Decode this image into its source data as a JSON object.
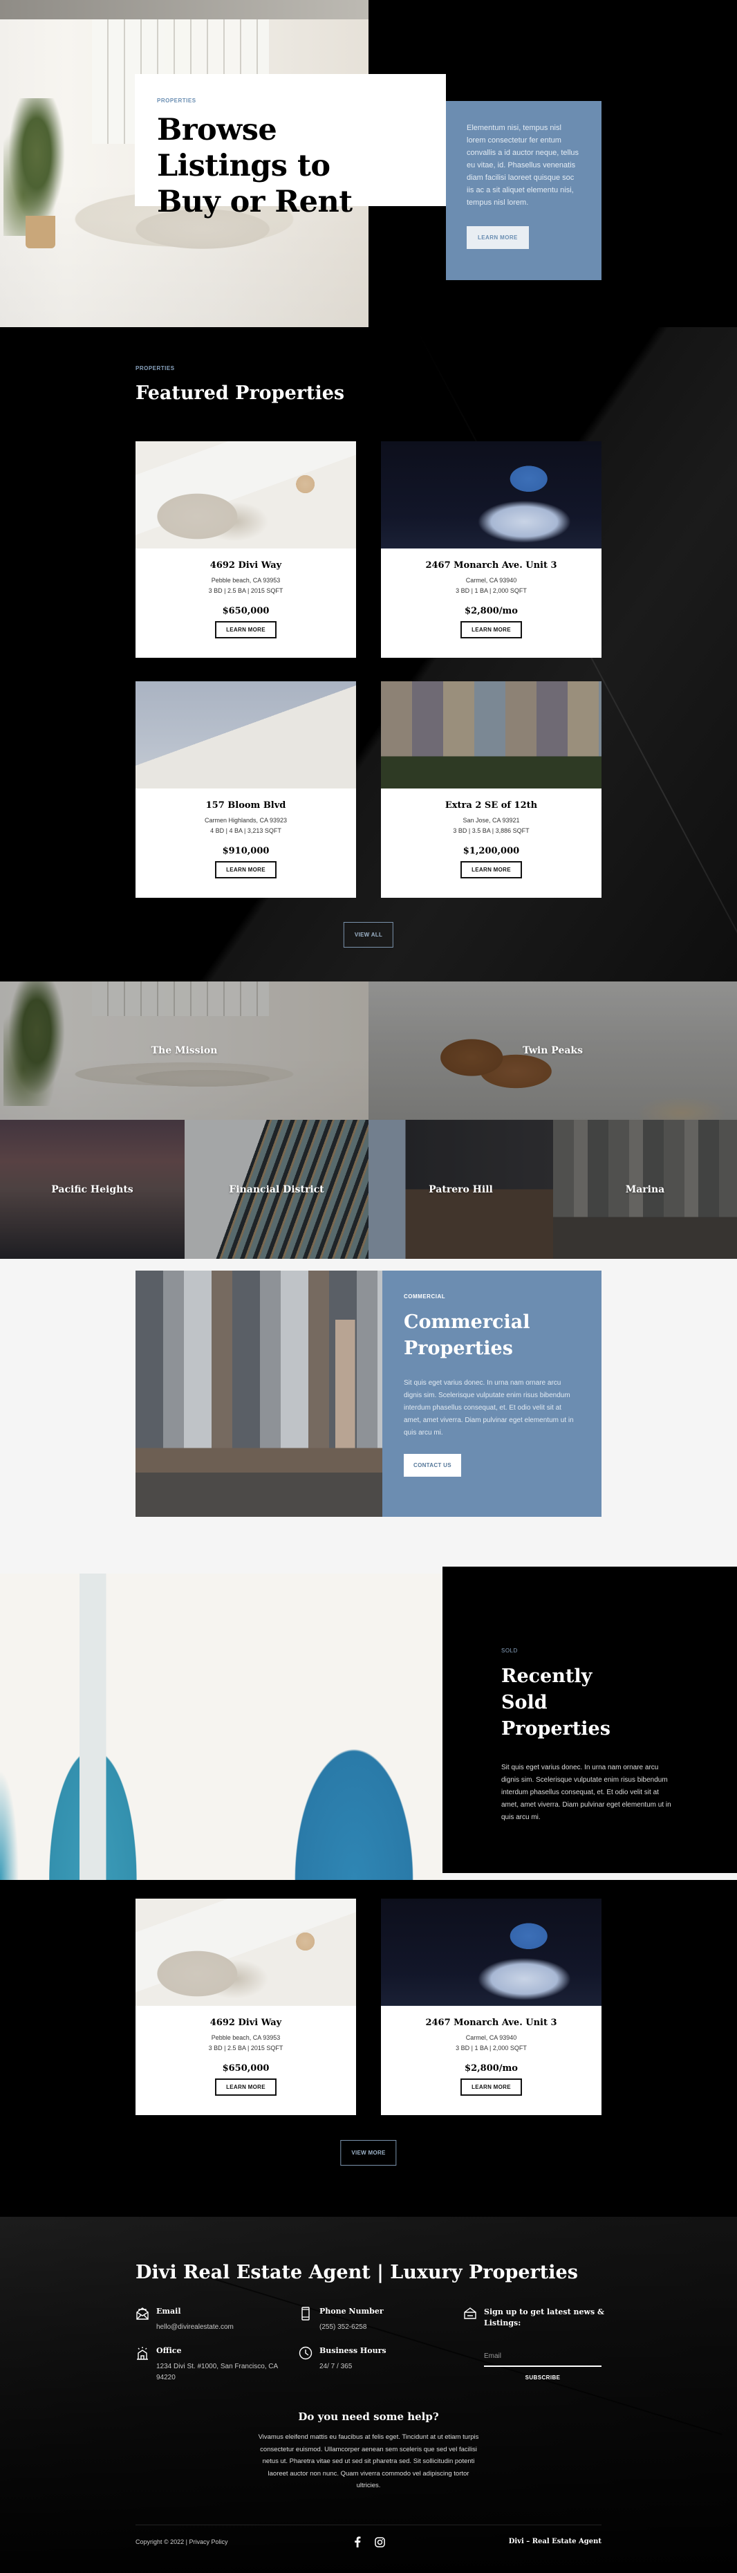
{
  "hero": {
    "eyebrow": "PROPERTIES",
    "title": "Browse Listings to Buy or Rent",
    "description": "Elementum nisi, tempus nisl lorem consectetur fer entum convallis a id auctor neque, tellus eu vitae, id. Phasellus venenatis diam facilisi laoreet quisque soc iis ac a sit aliquet elementu nisi, tempus nisl lorem.",
    "button_label": "LEARN MORE"
  },
  "featured": {
    "eyebrow": "PROPERTIES",
    "title": "Featured Properties",
    "listings": [
      {
        "title": "4692 Divi Way",
        "location": "Pebble beach, CA 93953",
        "details": "3 BD | 2.5 BA | 2015 SQFT",
        "price": "$650,000",
        "button_label": "LEARN MORE",
        "image": "flatlay"
      },
      {
        "title": "2467 Monarch Ave. Unit 3",
        "location": "Carmel, CA 93940",
        "details": "3 BD | 1 BA | 2,000 SQFT",
        "price": "$2,800/mo",
        "button_label": "LEARN MORE",
        "image": "cathedral"
      },
      {
        "title": "157 Bloom Blvd",
        "location": "Carmen Highlands, CA 93923",
        "details": "4 BD | 4 BA | 3,213 SQFT",
        "price": "$910,000",
        "button_label": "LEARN MORE",
        "image": "artdeco"
      },
      {
        "title": "Extra 2 SE of 12th",
        "location": "San Jose, CA 93921",
        "details": "3 BD | 3.5 BA | 3,886 SQFT",
        "price": "$1,200,000",
        "button_label": "LEARN MORE",
        "image": "victorian"
      }
    ],
    "view_all_label": "VIEW ALL"
  },
  "neighborhoods": [
    {
      "name": "The Mission"
    },
    {
      "name": "Twin Peaks"
    },
    {
      "name": "Pacific Heights"
    },
    {
      "name": "Financial District"
    },
    {
      "name": "Patrero Hill"
    },
    {
      "name": "Marina"
    }
  ],
  "commercial": {
    "eyebrow": "COMMERCIAL",
    "title": "Commercial Properties",
    "description": "Sit quis eget varius donec. In urna nam ornare arcu dignis sim. Scelerisque vulputate enim risus bibendum interdum phasellus consequat, et. Et odio velit sit at amet, amet viverra. Diam pulvinar eget elementum ut in quis arcu mi.",
    "button_label": "CONTACT US"
  },
  "sold": {
    "eyebrow": "SOLD",
    "title": "Recently Sold Properties",
    "description": "Sit quis eget varius donec. In urna nam ornare arcu dignis sim. Scelerisque vulputate enim risus bibendum interdum phasellus consequat, et. Et odio velit sit at amet, amet viverra. Diam pulvinar eget elementum ut in quis arcu mi.",
    "listings": [
      {
        "title": "4692 Divi Way",
        "location": "Pebble beach, CA 93953",
        "details": "3 BD | 2.5 BA | 2015 SQFT",
        "price": "$650,000",
        "button_label": "LEARN MORE",
        "image": "flatlay"
      },
      {
        "title": "2467 Monarch Ave. Unit 3",
        "location": "Carmel, CA 93940",
        "details": "3 BD | 1 BA | 2,000 SQFT",
        "price": "$2,800/mo",
        "button_label": "LEARN MORE",
        "image": "cathedral"
      }
    ],
    "view_more_label": "VIEW MORE"
  },
  "footer": {
    "title": "Divi Real Estate Agent | Luxury Properties",
    "email": {
      "label": "Email",
      "value": "hello@divirealestate.com",
      "icon": "envelope-icon"
    },
    "phone": {
      "label": "Phone Number",
      "value": "(255) 352-6258",
      "icon": "phone-icon"
    },
    "office": {
      "label": "Office",
      "value": "1234 Divi St. #1000, San Francisco, CA 94220",
      "icon": "building-icon"
    },
    "hours": {
      "label": "Business Hours",
      "value": "24/ 7 / 365",
      "icon": "clock-icon"
    },
    "signup": {
      "label": "Sign up to get latest news & Listings:",
      "email_placeholder": "Email",
      "email_value": "",
      "button_label": "SUBSCRIBE",
      "icon": "mailbox-icon"
    },
    "help": {
      "title": "Do you need some help?",
      "text": "Vivamus eleifend mattis eu faucibus at felis eget. Tincidunt at ut etiam turpis consectetur euismod. Ullamcorper aenean sem sceleris que sed vel facilisi netus ut. Pharetra vitae sed ut sed sit pharetra sed. Sit sollicitudin potenti laoreet auctor non nunc. Quam viverra commodo vel adipiscing tortor ultricies."
    },
    "copyright": "Copyright © 2022 | ",
    "privacy_label": "Privacy Policy",
    "socials": [
      {
        "name": "facebook"
      },
      {
        "name": "instagram"
      }
    ],
    "brand": "Divi – Real Estate Agent"
  },
  "colors": {
    "accent_blue": "#6c8db1",
    "background_dark": "#000000",
    "light_gray": "#f5f5f5"
  }
}
